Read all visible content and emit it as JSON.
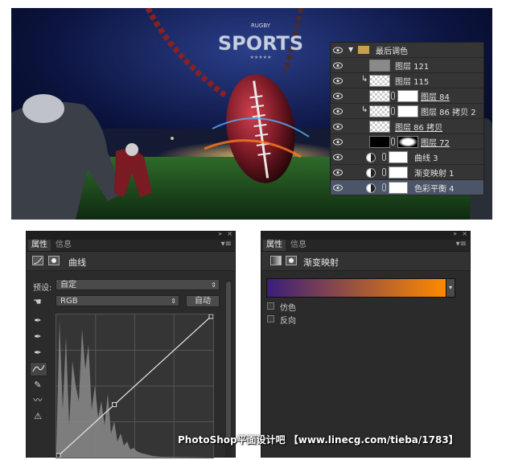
{
  "artwork": {
    "brand_small": "RUGBY",
    "brand_main": "SPORTS",
    "brand_stars": "★★★★★"
  },
  "layers": {
    "items": [
      {
        "name": "最后调色",
        "kind": "group",
        "visible": true
      },
      {
        "name": "图层 121",
        "kind": "layer",
        "visible": true
      },
      {
        "name": "图层 115",
        "kind": "clipped",
        "visible": true
      },
      {
        "name": "图层 84",
        "kind": "masked",
        "visible": true
      },
      {
        "name": "图层 86 拷贝 2",
        "kind": "clipped-masked",
        "visible": true
      },
      {
        "name": "图层 86 拷贝",
        "kind": "layer",
        "visible": true
      },
      {
        "name": "图层 72",
        "kind": "masked",
        "visible": true
      },
      {
        "name": "曲线 3",
        "kind": "adjustment",
        "visible": true
      },
      {
        "name": "渐变映射 1",
        "kind": "adjustment",
        "visible": true
      },
      {
        "name": "色彩平衡 4",
        "kind": "adjustment",
        "visible": true,
        "selected": true
      }
    ]
  },
  "curves_panel": {
    "tab_active": "属性",
    "tab_inactive": "信息",
    "title": "曲线",
    "preset_label": "预设:",
    "preset_value": "自定",
    "channel_value": "RGB",
    "auto_button": "自动",
    "curve_points": [
      [
        0,
        0
      ],
      [
        0.37,
        0.37
      ],
      [
        1,
        1
      ]
    ]
  },
  "gradient_panel": {
    "tab_active": "属性",
    "tab_inactive": "信息",
    "title": "渐变映射",
    "gradient_start": "#3a1e7a",
    "gradient_end": "#ff8a00",
    "dither_label": "仿色",
    "reverse_label": "反向"
  },
  "watermark": "PhotoShop平面设计吧 【www.linecg.com/tieba/1783】",
  "colors": {
    "panel_bg": "#2b2b2b",
    "selected_layer": "#4b5567",
    "accent": "#ff8a00"
  }
}
